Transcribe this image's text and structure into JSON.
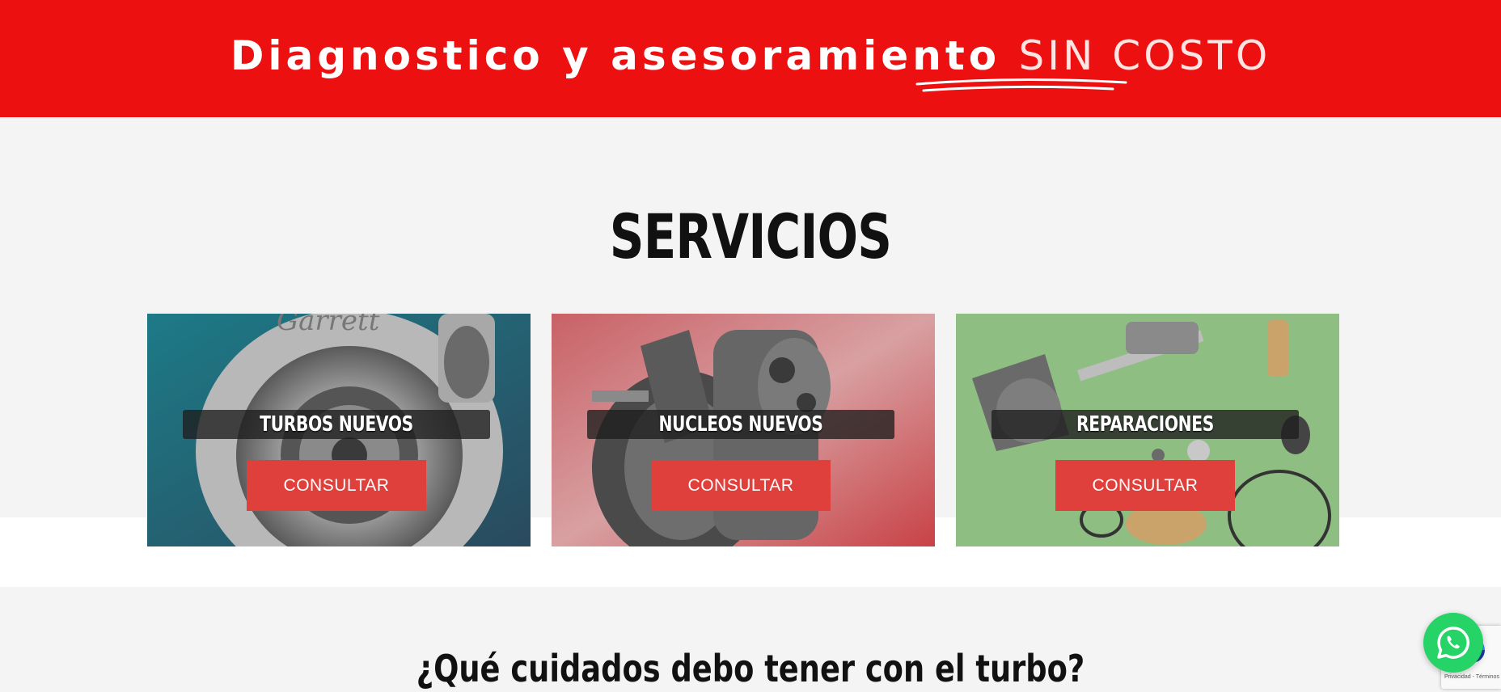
{
  "banner": {
    "text": "Diagnostico y asesoramiento ",
    "highlight": "SIN COSTO",
    "background": "#ec1010"
  },
  "services": {
    "title": "SERVICIOS",
    "cards": [
      {
        "label": "TURBOS NUEVOS",
        "button": "CONSULTAR",
        "tint": "#1f6f80"
      },
      {
        "label": "NUCLEOS NUEVOS",
        "button": "CONSULTAR",
        "tint": "#c8585c"
      },
      {
        "label": "REPARACIONES",
        "button": "CONSULTAR",
        "tint": "#86bb7a"
      }
    ],
    "button_color": "#e0403c"
  },
  "faq": {
    "question": "¿Qué cuidados debo tener con el turbo?"
  },
  "widgets": {
    "whatsapp_icon": "whatsapp-icon",
    "recaptcha_text": "Privacidad - Términos"
  }
}
